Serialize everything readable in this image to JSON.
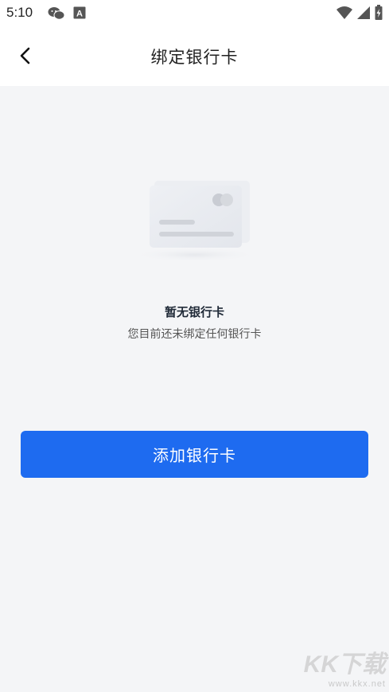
{
  "status_bar": {
    "time": "5:10",
    "left_icons": [
      "wechat-icon",
      "font-a-icon"
    ],
    "right_icons": [
      "wifi-icon",
      "signal-icon",
      "battery-charging-icon"
    ]
  },
  "header": {
    "title": "绑定银行卡",
    "back_icon": "chevron-left-icon"
  },
  "empty_state": {
    "illustration": "bank-card-icon",
    "title": "暂无银行卡",
    "subtitle": "您目前还未绑定任何银行卡"
  },
  "actions": {
    "add_card_label": "添加银行卡"
  },
  "watermark": {
    "logo": "KK下载",
    "url": "www.kkx.net"
  },
  "colors": {
    "primary": "#1e6bf0",
    "background": "#f4f5f7",
    "header_bg": "#ffffff"
  }
}
